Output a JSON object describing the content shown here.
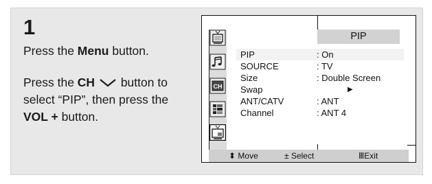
{
  "instructions": {
    "step_number": "1",
    "line1_pre": "Press the ",
    "line1_bold": "Menu",
    "line1_post": " button.",
    "line2_pre": "Press the ",
    "line2_bold": "CH",
    "line2_post": " button to",
    "line3": "select “PIP”, then press the",
    "line4_bold": "VOL +",
    "line4_post": " button."
  },
  "osd": {
    "title": "PIP",
    "icons": [
      "picture-icon",
      "sound-icon",
      "channel-icon",
      "setup-icon",
      "pip-icon"
    ],
    "rows": [
      {
        "label": "PIP",
        "value": ": On"
      },
      {
        "label": "SOURCE",
        "value": ": TV"
      },
      {
        "label": "Size",
        "value": ": Double Screen"
      },
      {
        "label": "Swap",
        "value": "▶"
      },
      {
        "label": "ANT/CATV",
        "value": ": ANT"
      },
      {
        "label": "Channel",
        "value": ": ANT 4"
      }
    ],
    "footer": {
      "move": "Move",
      "move_glyph": "⬍",
      "select": "Select",
      "select_glyph": "±",
      "exit": "Exit",
      "exit_glyph": "Ⅲ"
    },
    "colors": {
      "highlight": "#f2f2f2",
      "title_bg": "#d2d2d2",
      "footer_bg": "#cfcfcf"
    }
  }
}
